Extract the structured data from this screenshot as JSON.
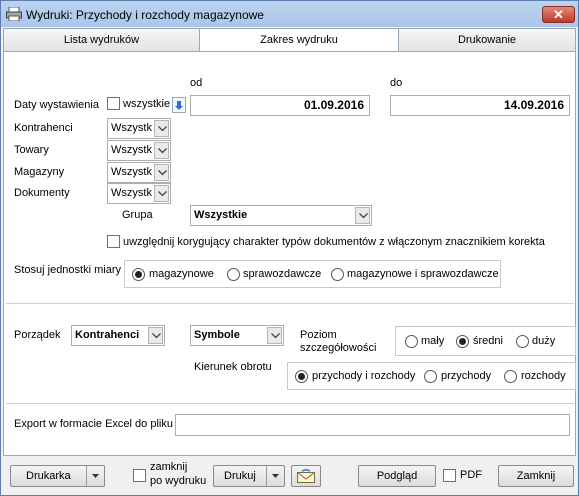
{
  "window": {
    "title": "Wydruki: Przychody i rozchody magazynowe",
    "close_label": "✕"
  },
  "tabs": [
    {
      "label": "Lista wydruków"
    },
    {
      "label": "Zakres wydruku"
    },
    {
      "label": "Drukowanie"
    }
  ],
  "dates": {
    "label": "Daty wystawienia",
    "all_label": "wszystkie",
    "from_header": "od",
    "to_header": "do",
    "from_value": "01.09.2016",
    "to_value": "14.09.2016"
  },
  "filters": {
    "kontrahenci": {
      "label": "Kontrahenci",
      "value": "Wszystk"
    },
    "towary": {
      "label": "Towary",
      "value": "Wszystk"
    },
    "magazyny": {
      "label": "Magazyny",
      "value": "Wszystk"
    },
    "dokumenty": {
      "label": "Dokumenty",
      "value": "Wszystk"
    }
  },
  "grupa": {
    "label": "Grupa",
    "value": "Wszystkie"
  },
  "korekta_label": "uwzględnij korygujący charakter typów dokumentów z włączonym znacznikiem korekta",
  "jednostki": {
    "label": "Stosuj jednostki miary",
    "options": [
      "magazynowe",
      "sprawozdawcze",
      "magazynowe i sprawozdawcze"
    ]
  },
  "porzadek": {
    "label": "Porządek",
    "value1": "Kontrahenci",
    "value2": "Symbole"
  },
  "poziom": {
    "label_line1": "Poziom",
    "label_line2": "szczegółowości",
    "options": [
      "mały",
      "średni",
      "duży"
    ]
  },
  "kierunek": {
    "label": "Kierunek obrotu",
    "options": [
      "przychody i rozchody",
      "przychody",
      "rozchody"
    ]
  },
  "export": {
    "label": "Export w formacie Excel do pliku",
    "value": ""
  },
  "bottom": {
    "drukarka": "Drukarka",
    "zamknij_po_line1": "zamknij",
    "zamknij_po_line2": "po wydruku",
    "drukuj": "Drukuj",
    "podglad": "Podgląd",
    "pdf": "PDF",
    "zamknij": "Zamknij"
  }
}
